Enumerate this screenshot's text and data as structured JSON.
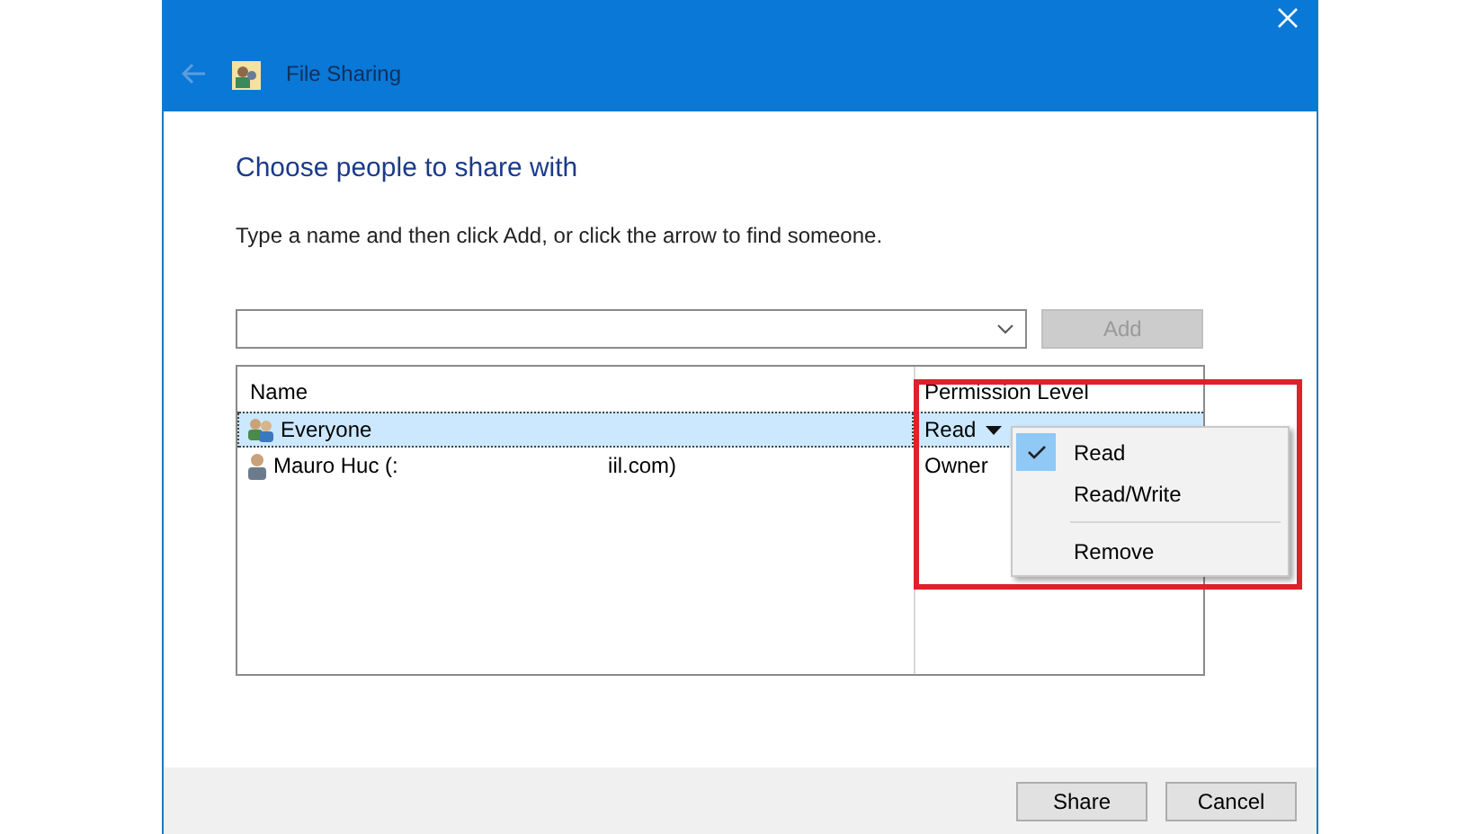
{
  "window": {
    "title": "File Sharing"
  },
  "heading": "Choose people to share with",
  "instruction": "Type a name and then click Add, or click the arrow to find someone.",
  "add_button": {
    "label": "Add",
    "disabled": true
  },
  "table": {
    "columns": [
      "Name",
      "Permission Level"
    ],
    "rows": [
      {
        "kind": "group",
        "name": "Everyone",
        "permission": "Read",
        "has_dropdown": true,
        "selected": true
      },
      {
        "kind": "user",
        "name": "Mauro Huc (:                                   iil.com)",
        "permission": "Owner",
        "has_dropdown": false,
        "selected": false
      }
    ]
  },
  "permission_menu": {
    "items": [
      {
        "kind": "option",
        "label": "Read",
        "checked": true
      },
      {
        "kind": "option",
        "label": "Read/Write",
        "checked": false
      },
      {
        "kind": "separator"
      },
      {
        "kind": "option",
        "label": "Remove",
        "checked": false
      }
    ]
  },
  "buttons": [
    "Share",
    "Cancel"
  ]
}
